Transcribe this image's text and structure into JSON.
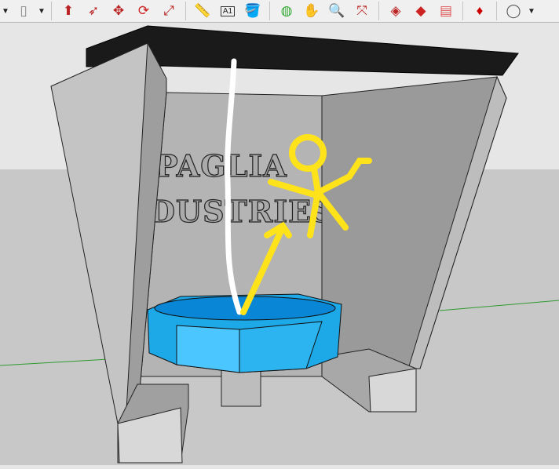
{
  "toolbar": {
    "tools": [
      {
        "name": "rectangle-tool",
        "glyph": "▯",
        "color": "#888"
      },
      {
        "name": "push-pull-tool",
        "glyph": "⬆",
        "color": "#b22"
      },
      {
        "name": "follow-me-tool",
        "glyph": "➶",
        "color": "#b22"
      },
      {
        "name": "move-tool",
        "glyph": "✥",
        "color": "#b22"
      },
      {
        "name": "rotate-tool",
        "glyph": "⟳",
        "color": "#c22"
      },
      {
        "name": "scale-tool",
        "glyph": "⤢",
        "color": "#b22"
      },
      {
        "name": "tape-measure-tool",
        "glyph": "📏",
        "color": "#aa0"
      },
      {
        "name": "text-tool",
        "glyph": "A1",
        "color": "#222"
      },
      {
        "name": "paint-bucket-tool",
        "glyph": "🪣",
        "color": "#c90"
      },
      {
        "name": "orbit-tool",
        "glyph": "◍",
        "color": "#3a3"
      },
      {
        "name": "pan-tool",
        "glyph": "✋",
        "color": "#d9b"
      },
      {
        "name": "zoom-tool",
        "glyph": "🔍",
        "color": "#135"
      },
      {
        "name": "zoom-extents-tool",
        "glyph": "⤧",
        "color": "#b22"
      },
      {
        "name": "3d-warehouse",
        "glyph": "◈",
        "color": "#b22"
      },
      {
        "name": "extension-warehouse",
        "glyph": "◆",
        "color": "#c22"
      },
      {
        "name": "send-to-layout",
        "glyph": "▤",
        "color": "#d55"
      },
      {
        "name": "extension-manager",
        "glyph": "♦",
        "color": "#c00"
      },
      {
        "name": "account",
        "glyph": "◯",
        "color": "#555"
      }
    ]
  },
  "model": {
    "sign_line1": "PAGLIA",
    "sign_line2": "DUSTRIES",
    "colors": {
      "basin": "#29b6f6",
      "sky": "#e6e6e6",
      "ground": "#c8c8c8",
      "annotation": "#ffe31a"
    }
  }
}
